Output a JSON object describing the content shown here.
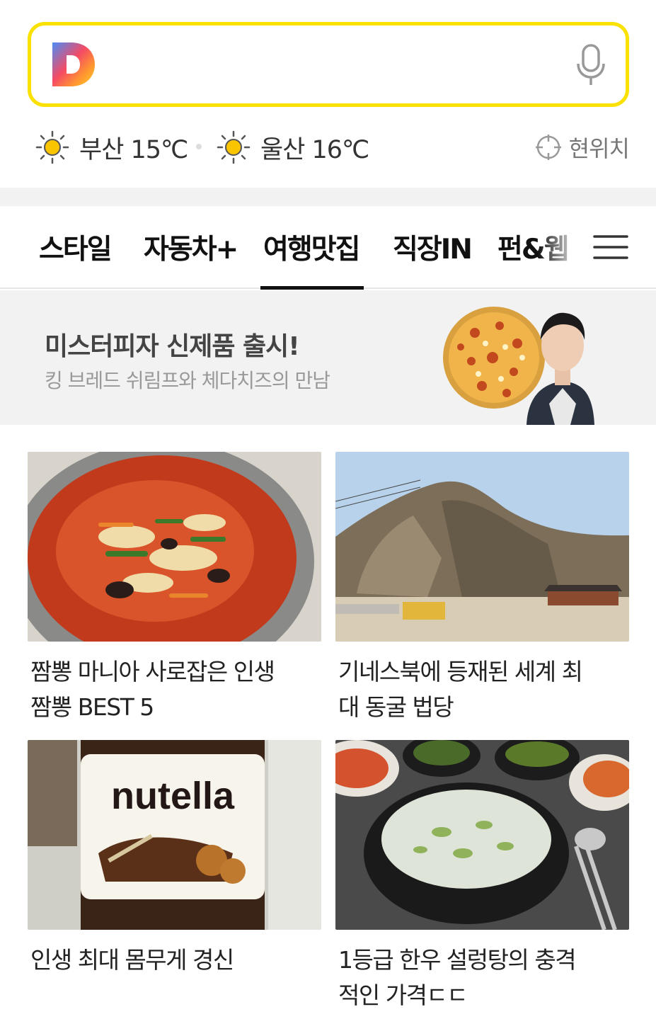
{
  "search": {
    "logo_letter": "D",
    "mic_icon": "microphone-icon"
  },
  "weather": [
    {
      "city_temp": "부산 15℃",
      "icon": "sun-icon"
    },
    {
      "city_temp": "울산 16℃",
      "icon": "sun-icon"
    }
  ],
  "location": {
    "label": "현위치",
    "icon": "target-icon"
  },
  "tabs": [
    {
      "label": "스타일"
    },
    {
      "label": "자동차+"
    },
    {
      "label": "여행맛집",
      "active": true
    },
    {
      "label": "직장IN"
    },
    {
      "label": "펀&웹"
    }
  ],
  "banner": {
    "title": "미스터피자 신제품 출시!",
    "subtitle": "킹 브레드 쉬림프와 체다치즈의 만남"
  },
  "cards": [
    {
      "title": "짬뽕 마니아 사로잡은 인생 짬뽕 BEST 5"
    },
    {
      "title": "기네스북에 등재된 세계 최대 동굴 법당"
    },
    {
      "title": "인생 최대 몸무게 경신",
      "jar_text": "nutella"
    },
    {
      "title": "1등급 한우 설렁탕의 충격적인 가격ㄷㄷ"
    }
  ],
  "colors": {
    "accent": "#fae100",
    "active_tab": "#111111",
    "banner_bg": "#f2f2f2"
  }
}
